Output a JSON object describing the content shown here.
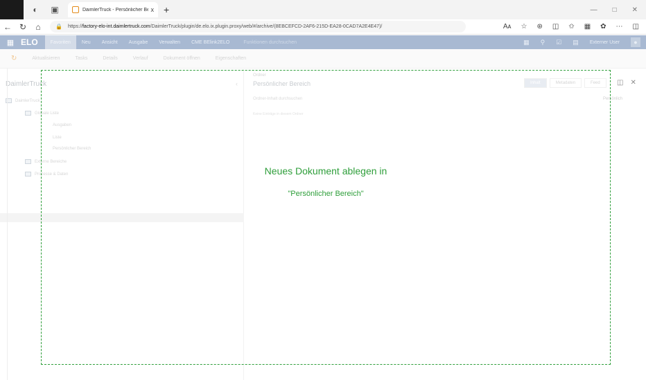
{
  "browser": {
    "tab_title": "DaimlerTruck - Persönlicher Berei",
    "tab_close": "x",
    "new_tab": "+",
    "url_prefix": "https://",
    "url_host": "factory-elo-int.daimlertruck.com",
    "url_path": "/DaimlerTruck/plugin/de.elo.ix.plugin.proxy/web/#/archive/(8EBCEFCD-2AF6-215D-EA28-0CAD7A2E4E47)/",
    "read_aloud": "Aᴀ"
  },
  "app": {
    "logo": "ELO",
    "menu": [
      "Favoriten",
      "Neu",
      "Ansicht",
      "Ausgabe",
      "Verwalten",
      "CME BElink2ELO"
    ],
    "active_menu": "Favoriten",
    "search_placeholder": "Funktionen durchsuchen",
    "user": "Externer User"
  },
  "ribbon": {
    "items": [
      "Aktualisieren",
      "Tasks",
      "Details",
      "Verlauf",
      "Dokument öffnen",
      "Eigenschaften"
    ]
  },
  "left_panel": {
    "title": "DaimlerTruck",
    "tree": [
      {
        "label": "DaimlerTruck",
        "level": 0
      },
      {
        "label": "Globale Liste",
        "level": 1
      },
      {
        "label": "Ausgaben",
        "level": 2
      },
      {
        "label": "Liste",
        "level": 2
      },
      {
        "label": "Persönlicher Bereich",
        "level": 2
      },
      {
        "label": "Externe Bereiche",
        "level": 1
      },
      {
        "label": "Prozesse & Daten",
        "level": 1
      }
    ]
  },
  "right_panel": {
    "crumb": "Ordner",
    "title": "Persönlicher Bereich",
    "tabs": [
      "Inhalt",
      "Metadaten",
      "Feed"
    ],
    "active_tab": "Inhalt",
    "filter_placeholder": "Ordner-Inhalt durchsuchen",
    "sort": "Persönlich",
    "empty_text": "Keine Einträge in diesem Ordner"
  },
  "dropzone": {
    "title": "Neues Dokument ablegen in",
    "target": "\"Persönlicher Bereich\"",
    "accent": "#2e9e3a"
  },
  "colors": {
    "app_header": "#a8b9d2",
    "dropzone_border": "#2e9e3a"
  }
}
